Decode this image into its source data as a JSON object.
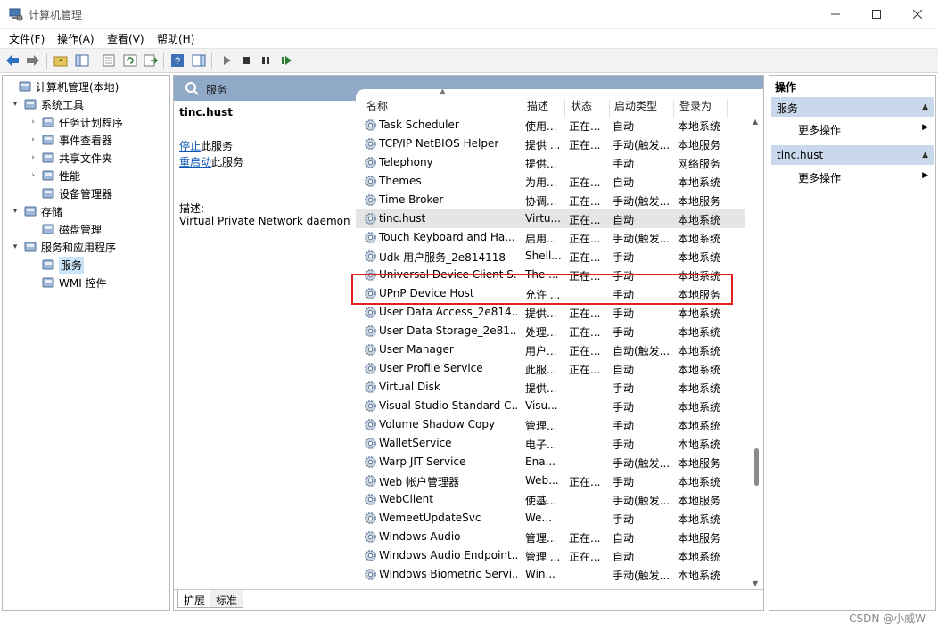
{
  "window": {
    "title": "计算机管理",
    "watermark": "CSDN @小威W"
  },
  "menu": [
    "文件(F)",
    "操作(A)",
    "查看(V)",
    "帮助(H)"
  ],
  "tree": [
    {
      "label": "计算机管理(本地)",
      "level": 0,
      "arrow": "",
      "icon": "computer-management-icon"
    },
    {
      "label": "系统工具",
      "level": 1,
      "arrow": "⌄",
      "icon": "tools-icon"
    },
    {
      "label": "任务计划程序",
      "level": 2,
      "arrow": "›",
      "icon": "clock-icon"
    },
    {
      "label": "事件查看器",
      "level": 2,
      "arrow": "›",
      "icon": "event-viewer-icon"
    },
    {
      "label": "共享文件夹",
      "level": 2,
      "arrow": "›",
      "icon": "shared-folder-icon"
    },
    {
      "label": "性能",
      "level": 2,
      "arrow": "›",
      "icon": "performance-icon"
    },
    {
      "label": "设备管理器",
      "level": 2,
      "arrow": "",
      "icon": "device-manager-icon"
    },
    {
      "label": "存储",
      "level": 1,
      "arrow": "⌄",
      "icon": "storage-icon"
    },
    {
      "label": "磁盘管理",
      "level": 2,
      "arrow": "",
      "icon": "disk-icon"
    },
    {
      "label": "服务和应用程序",
      "level": 1,
      "arrow": "⌄",
      "icon": "services-apps-icon"
    },
    {
      "label": "服务",
      "level": 2,
      "arrow": "",
      "icon": "services-icon",
      "selected": true
    },
    {
      "label": "WMI 控件",
      "level": 2,
      "arrow": "",
      "icon": "wmi-icon"
    }
  ],
  "center": {
    "header": "服务",
    "selected_name": "tinc.hust",
    "stop_link": "停止",
    "stop_suffix": "此服务",
    "restart_link": "重启动",
    "restart_suffix": "此服务",
    "desc_label": "描述:",
    "desc_text": "Virtual Private Network daemon",
    "columns": {
      "name": "名称",
      "desc": "描述",
      "state": "状态",
      "start": "启动类型",
      "logon": "登录为"
    },
    "tabs": [
      "扩展",
      "标准"
    ]
  },
  "services": [
    {
      "name": "Task Scheduler",
      "desc": "使用...",
      "state": "正在...",
      "start": "自动",
      "logon": "本地系统"
    },
    {
      "name": "TCP/IP NetBIOS Helper",
      "desc": "提供 ...",
      "state": "正在...",
      "start": "手动(触发...",
      "logon": "本地服务"
    },
    {
      "name": "Telephony",
      "desc": "提供...",
      "state": "",
      "start": "手动",
      "logon": "网络服务"
    },
    {
      "name": "Themes",
      "desc": "为用...",
      "state": "正在...",
      "start": "自动",
      "logon": "本地系统"
    },
    {
      "name": "Time Broker",
      "desc": "协调...",
      "state": "正在...",
      "start": "手动(触发...",
      "logon": "本地服务"
    },
    {
      "name": "tinc.hust",
      "desc": "Virtu...",
      "state": "正在...",
      "start": "自动",
      "logon": "本地系统",
      "selected": true
    },
    {
      "name": "Touch Keyboard and Ha...",
      "desc": "启用...",
      "state": "正在...",
      "start": "手动(触发...",
      "logon": "本地系统"
    },
    {
      "name": "Udk 用户服务_2e814118",
      "desc": "Shell...",
      "state": "正在...",
      "start": "手动",
      "logon": "本地系统"
    },
    {
      "name": "Universal Device Client S...",
      "desc": "The ...",
      "state": "正在...",
      "start": "手动",
      "logon": "本地系统"
    },
    {
      "name": "UPnP Device Host",
      "desc": "允许 ...",
      "state": "",
      "start": "手动",
      "logon": "本地服务"
    },
    {
      "name": "User Data Access_2e814...",
      "desc": "提供...",
      "state": "正在...",
      "start": "手动",
      "logon": "本地系统"
    },
    {
      "name": "User Data Storage_2e81...",
      "desc": "处理...",
      "state": "正在...",
      "start": "手动",
      "logon": "本地系统"
    },
    {
      "name": "User Manager",
      "desc": "用户...",
      "state": "正在...",
      "start": "自动(触发...",
      "logon": "本地系统"
    },
    {
      "name": "User Profile Service",
      "desc": "此服...",
      "state": "正在...",
      "start": "自动",
      "logon": "本地系统"
    },
    {
      "name": "Virtual Disk",
      "desc": "提供...",
      "state": "",
      "start": "手动",
      "logon": "本地系统"
    },
    {
      "name": "Visual Studio Standard C...",
      "desc": "Visu...",
      "state": "",
      "start": "手动",
      "logon": "本地系统"
    },
    {
      "name": "Volume Shadow Copy",
      "desc": "管理...",
      "state": "",
      "start": "手动",
      "logon": "本地系统"
    },
    {
      "name": "WalletService",
      "desc": "电子...",
      "state": "",
      "start": "手动",
      "logon": "本地系统"
    },
    {
      "name": "Warp JIT Service",
      "desc": "Ena...",
      "state": "",
      "start": "手动(触发...",
      "logon": "本地服务"
    },
    {
      "name": "Web 帐户管理器",
      "desc": "Web...",
      "state": "正在...",
      "start": "手动",
      "logon": "本地系统"
    },
    {
      "name": "WebClient",
      "desc": "使基...",
      "state": "",
      "start": "手动(触发...",
      "logon": "本地服务"
    },
    {
      "name": "WemeetUpdateSvc",
      "desc": "We...",
      "state": "",
      "start": "手动",
      "logon": "本地系统"
    },
    {
      "name": "Windows Audio",
      "desc": "管理...",
      "state": "正在...",
      "start": "自动",
      "logon": "本地服务"
    },
    {
      "name": "Windows Audio Endpoint...",
      "desc": "管理 ...",
      "state": "正在...",
      "start": "自动",
      "logon": "本地系统"
    },
    {
      "name": "Windows Biometric Servi...",
      "desc": "Win...",
      "state": "",
      "start": "手动(触发...",
      "logon": "本地系统"
    }
  ],
  "actions": {
    "title": "操作",
    "groups": [
      {
        "label": "服务",
        "item": "更多操作"
      },
      {
        "label": "tinc.hust",
        "item": "更多操作"
      }
    ]
  }
}
